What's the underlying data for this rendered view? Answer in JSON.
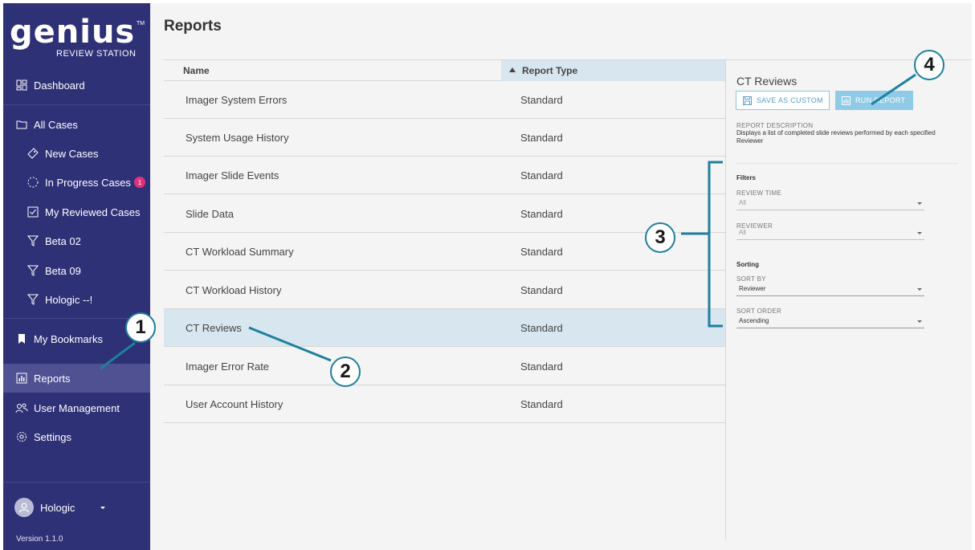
{
  "app": {
    "logo_word": "genius",
    "logo_tm": "TM",
    "logo_sub": "REVIEW STATION",
    "version": "Version 1.1.0"
  },
  "sidebar": {
    "items": [
      {
        "label": "Dashboard",
        "icon": "dashboard-icon"
      },
      {
        "label": "All Cases",
        "icon": "folder-icon"
      },
      {
        "label": "New Cases",
        "icon": "tag-icon"
      },
      {
        "label": "In Progress Cases",
        "icon": "progress-circle-icon",
        "badge": "1"
      },
      {
        "label": "My Reviewed Cases",
        "icon": "checkbox-icon"
      },
      {
        "label": "Beta 02",
        "icon": "filter-icon"
      },
      {
        "label": "Beta 09",
        "icon": "filter-icon"
      },
      {
        "label": "Hologic --!",
        "icon": "filter-icon"
      },
      {
        "label": "My Bookmarks",
        "icon": "bookmark-icon"
      },
      {
        "label": "Reports",
        "icon": "bar-chart-icon",
        "active": true
      },
      {
        "label": "User Management",
        "icon": "users-icon"
      },
      {
        "label": "Settings",
        "icon": "gear-icon"
      }
    ],
    "user": {
      "name": "Hologic",
      "icon": "user-avatar-icon"
    }
  },
  "main": {
    "title": "Reports",
    "columns": {
      "name": "Name",
      "type": "Report Type",
      "sort": "ascending"
    },
    "rows": [
      {
        "name": "Imager System Errors",
        "type": "Standard"
      },
      {
        "name": "System Usage History",
        "type": "Standard"
      },
      {
        "name": "Imager Slide Events",
        "type": "Standard"
      },
      {
        "name": "Slide Data",
        "type": "Standard"
      },
      {
        "name": "CT Workload Summary",
        "type": "Standard"
      },
      {
        "name": "CT Workload History",
        "type": "Standard"
      },
      {
        "name": "CT Reviews",
        "type": "Standard",
        "selected": true
      },
      {
        "name": "Imager Error Rate",
        "type": "Standard"
      },
      {
        "name": "User Account History",
        "type": "Standard"
      }
    ]
  },
  "panel": {
    "title": "CT Reviews",
    "save_label": "SAVE AS CUSTOM",
    "run_label": "RUN REPORT",
    "desc_label": "REPORT DESCRIPTION",
    "desc_text": "Displays a list of completed slide reviews performed by each specified Reviewer",
    "filters_label": "Filters",
    "review_time_label": "REVIEW TIME",
    "review_time_value": "All",
    "reviewer_label": "REVIEWER",
    "reviewer_value": "All",
    "sorting_label": "Sorting",
    "sort_by_label": "SORT BY",
    "sort_by_value": "Reviewer",
    "sort_order_label": "SORT ORDER",
    "sort_order_value": "Ascending"
  },
  "annotations": {
    "c1": "1",
    "c2": "2",
    "c3": "3",
    "c4": "4",
    "color": "#1e7f9e"
  },
  "colors": {
    "sidebar_bg": "#2f3177",
    "sidebar_active": "#4f5192",
    "selected_row": "#d7e6ef",
    "accent": "#8fcbe6",
    "badge": "#e0327a"
  }
}
